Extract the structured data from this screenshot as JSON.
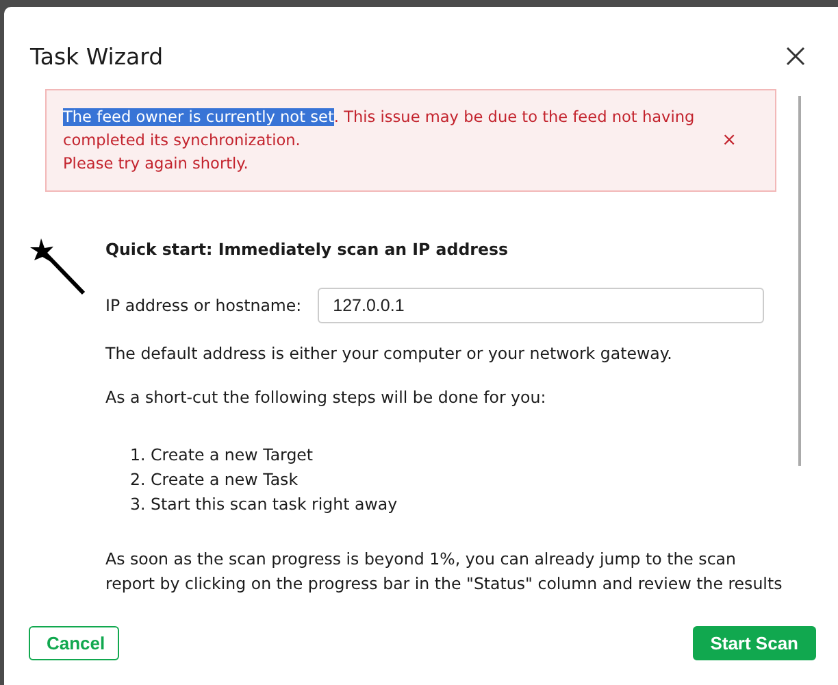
{
  "dialog": {
    "title": "Task Wizard"
  },
  "alert": {
    "message": [
      {
        "text": "The feed owner is currently not set",
        "highlighted": true
      },
      {
        "text": ". This issue may be due to the feed not having completed its synchronization.",
        "highlighted": false
      }
    ],
    "message_2": "Please try again shortly.",
    "dismiss": "×"
  },
  "heading": "Quick start: Immediately scan an IP address",
  "field": {
    "label": "IP address or hostname:",
    "value": "127.0.0.1"
  },
  "paragraphs": [
    "The default address is either your computer or your network gateway.",
    "As a short-cut the following steps will be done for you:"
  ],
  "steps": [
    "1. Create a new Target",
    "2. Create a new Task",
    "3. Start this scan task right away"
  ],
  "note": "As soon as the scan progress is beyond 1%, you can already jump to the scan report by clicking on the progress bar in the \"Status\" column and review the results",
  "buttons": [
    {
      "label": "Cancel",
      "kind": "outline"
    },
    {
      "label": "Start Scan",
      "kind": "primary"
    }
  ]
}
